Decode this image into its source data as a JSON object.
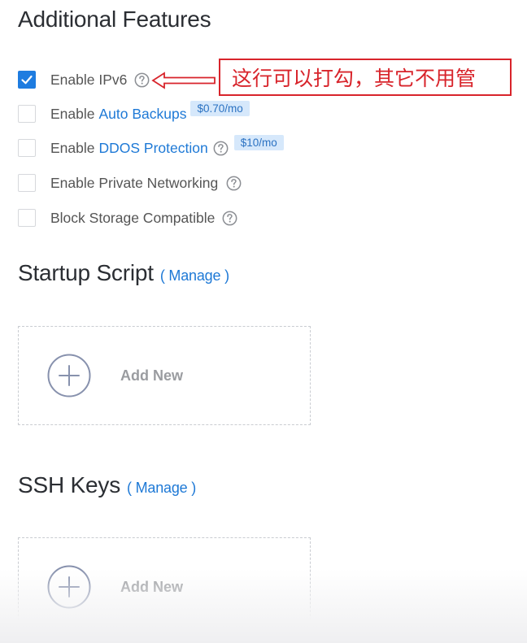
{
  "additional_features": {
    "title": "Additional Features",
    "options": [
      {
        "label": "Enable IPv6",
        "checked": true
      },
      {
        "label_prefix": "Enable",
        "link": "Auto Backups",
        "price": "$0.70/mo",
        "checked": false
      },
      {
        "label_prefix": "Enable",
        "link": "DDOS Protection",
        "price": "$10/mo",
        "checked": false
      },
      {
        "label": "Enable Private Networking",
        "checked": false
      },
      {
        "label": "Block Storage Compatible",
        "checked": false
      }
    ]
  },
  "annotation": {
    "text": "这行可以打勾，其它不用管",
    "color": "#d8242b"
  },
  "startup_script": {
    "title": "Startup Script",
    "manage_label": "( Manage )",
    "add_new_label": "Add New"
  },
  "ssh_keys": {
    "title": "SSH Keys",
    "manage_label": "( Manage )",
    "add_new_label": "Add New"
  },
  "colors": {
    "accent": "#1e7ce0",
    "link": "#1e79d6",
    "price_badge_bg": "#d6e8fb",
    "annotation_red": "#d8242b"
  },
  "icons": {
    "checkbox_checked": "check-icon",
    "help": "help-circle-icon",
    "add": "plus-circle-icon",
    "annotation_arrow": "arrow-left-icon"
  }
}
